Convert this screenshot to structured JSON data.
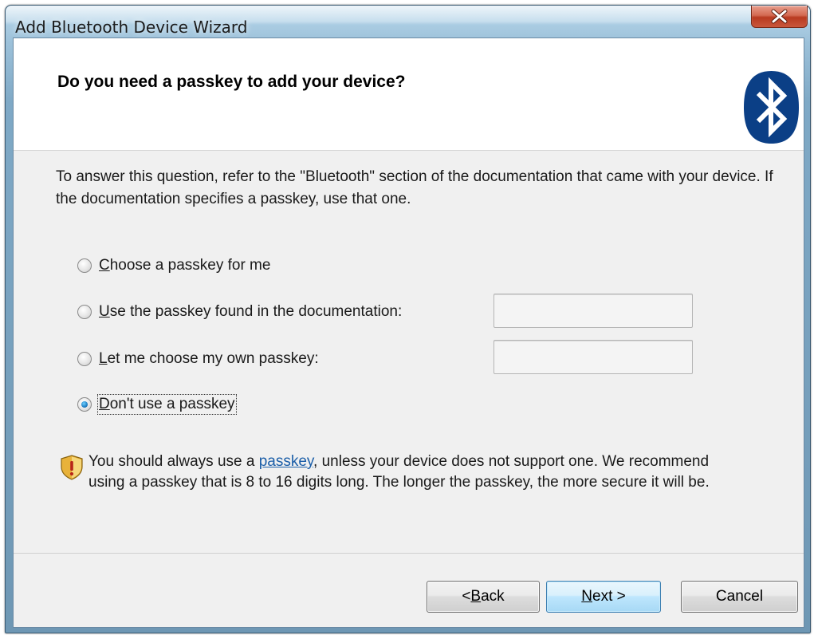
{
  "window": {
    "title": "Add Bluetooth Device Wizard"
  },
  "header": {
    "heading": "Do you need a passkey to add your device?"
  },
  "instructions": "To answer this question, refer to the \"Bluetooth\" section of the documentation that came with your device. If the documentation specifies a passkey, use that one.",
  "options": [
    {
      "label_key": "C",
      "label_rest": "hoose a passkey for me",
      "checked": false
    },
    {
      "label_key": "U",
      "label_rest": "se the passkey found in the documentation:",
      "checked": false,
      "field_value": ""
    },
    {
      "label_key": "L",
      "label_rest": "et me choose my own passkey:",
      "checked": false,
      "field_value": ""
    },
    {
      "label_key": "D",
      "label_rest": "on't use a passkey",
      "checked": true
    }
  ],
  "warning": {
    "prefix": "You should always use a ",
    "link": "passkey",
    "suffix": ", unless your device does not support one. We recommend using a passkey that is 8 to 16 digits long. The longer the passkey, the more secure it will be."
  },
  "buttons": {
    "back": {
      "pre": "< ",
      "key": "B",
      "rest": "ack"
    },
    "next": {
      "key": "N",
      "rest": "ext >"
    },
    "cancel": "Cancel"
  },
  "icons": [
    "close-icon",
    "bluetooth-icon",
    "shield-warning-icon"
  ]
}
